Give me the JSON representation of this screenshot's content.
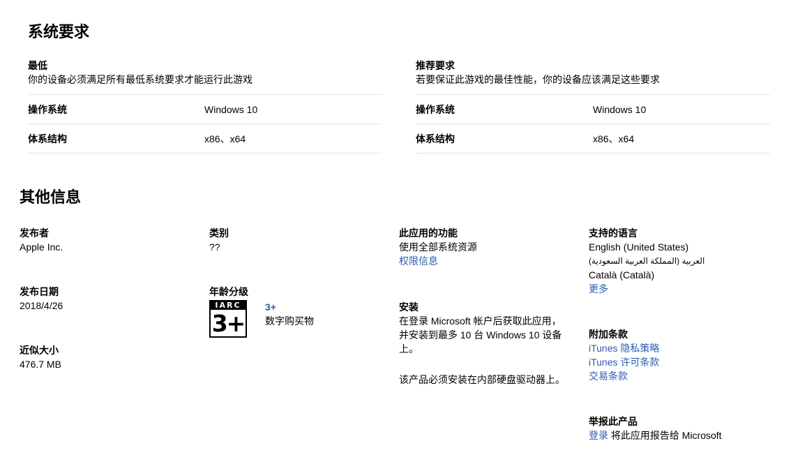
{
  "sysreq": {
    "title": "系统要求",
    "minimum": {
      "heading": "最低",
      "desc": "你的设备必须满足所有最低系统要求才能运行此游戏",
      "rows": [
        {
          "label": "操作系统",
          "value": "Windows 10"
        },
        {
          "label": "体系结构",
          "value": "x86、x64"
        }
      ]
    },
    "recommended": {
      "heading": "推荐要求",
      "desc": "若要保证此游戏的最佳性能，你的设备应该满足这些要求",
      "rows": [
        {
          "label": "操作系统",
          "value": "Windows 10"
        },
        {
          "label": "体系结构",
          "value": "x86、x64"
        }
      ]
    }
  },
  "info": {
    "title": "其他信息",
    "publisher": {
      "label": "发布者",
      "value": "Apple Inc."
    },
    "release_date": {
      "label": "发布日期",
      "value": "2018/4/26"
    },
    "size": {
      "label": "近似大小",
      "value": "476.7 MB"
    },
    "category": {
      "label": "类别",
      "value": "??"
    },
    "age_rating": {
      "label": "年龄分级",
      "badge_top": "IARC",
      "badge_num": "3+",
      "rating": "3+",
      "desc": "数字购买物"
    },
    "capabilities": {
      "label": "此应用的功能",
      "value": "使用全部系统资源",
      "link": "权限信息"
    },
    "installation": {
      "label": "安装",
      "lines": [
        "在登录 Microsoft 帐户后获取此应用，",
        "并安装到最多 10 台 Windows 10 设备",
        "上。"
      ],
      "note": "该产品必须安装在内部硬盘驱动器上。"
    },
    "languages": {
      "label": "支持的语言",
      "items": [
        "English (United States)",
        "العربية (المملكة العربية السعودية)",
        "Català (Català)"
      ],
      "more": "更多"
    },
    "terms": {
      "label": "附加条款",
      "links": [
        "iTunes 隐私策略",
        "iTunes 许可条款",
        "交易条款"
      ]
    },
    "report": {
      "label": "举报此产品",
      "login_link": "登录",
      "text": "将此应用报告给 Microsoft"
    }
  }
}
